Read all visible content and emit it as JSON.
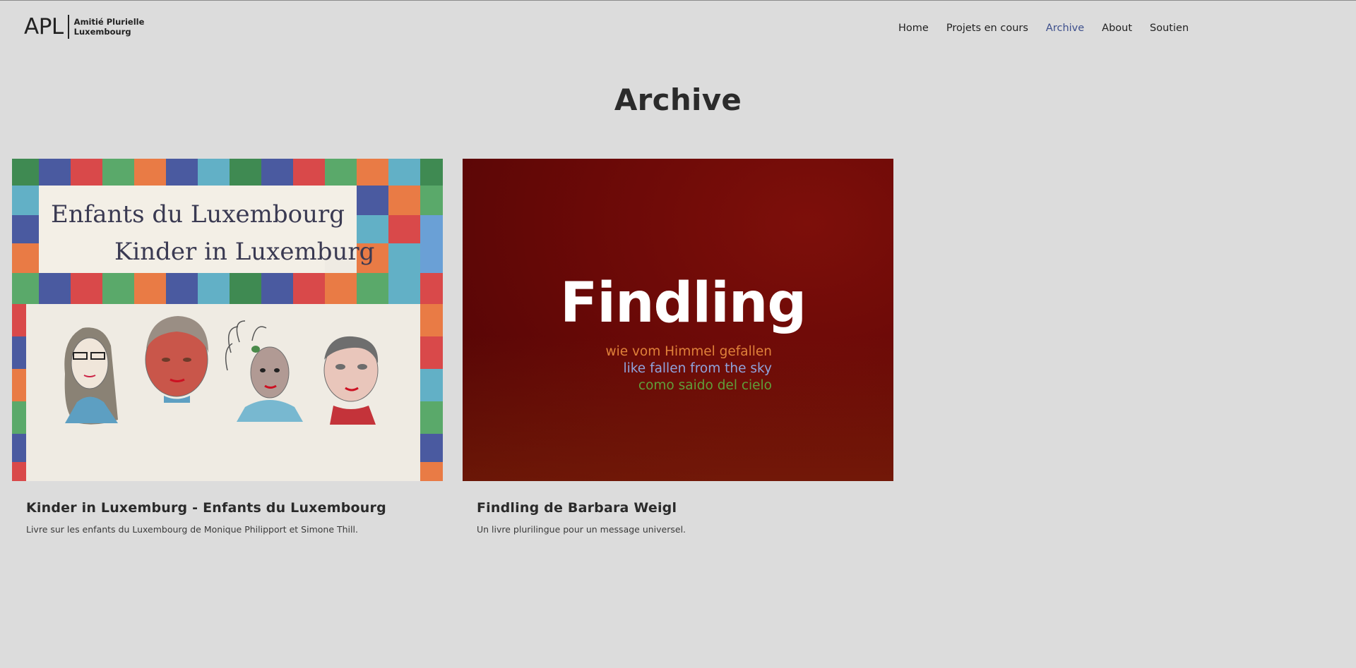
{
  "site": {
    "logo_mark": "APL",
    "logo_line1": "Amitié Plurielle",
    "logo_line2": "Luxembourg"
  },
  "nav": {
    "items": [
      {
        "label": "Home"
      },
      {
        "label": "Projets en cours"
      },
      {
        "label": "Archive",
        "active": true
      },
      {
        "label": "About"
      },
      {
        "label": "Soutien"
      }
    ]
  },
  "page": {
    "title": "Archive"
  },
  "cards": [
    {
      "image": {
        "line1": "Enfants du Luxembourg",
        "line2": "Kinder in Luxemburg"
      },
      "title": "Kinder in Luxemburg - Enfants du Luxembourg",
      "description": "Livre sur les enfants du Luxembourg de Monique Philipport et Simone Thill."
    },
    {
      "image": {
        "headline": "Findling",
        "line1": "wie vom Himmel gefallen",
        "line2": "like fallen from the sky",
        "line3": "como saido del cielo"
      },
      "title": "Findling de Barbara Weigl",
      "description": "Un livre plurilingue pour un message universel."
    }
  ],
  "colors": {
    "background": "#dcdcdc",
    "nav_active": "#3d4f8c",
    "findling_bg": "#6a0907",
    "findling_line1": "#e0813a",
    "findling_line2": "#8fa3dc",
    "findling_line3": "#5f9f3a"
  }
}
